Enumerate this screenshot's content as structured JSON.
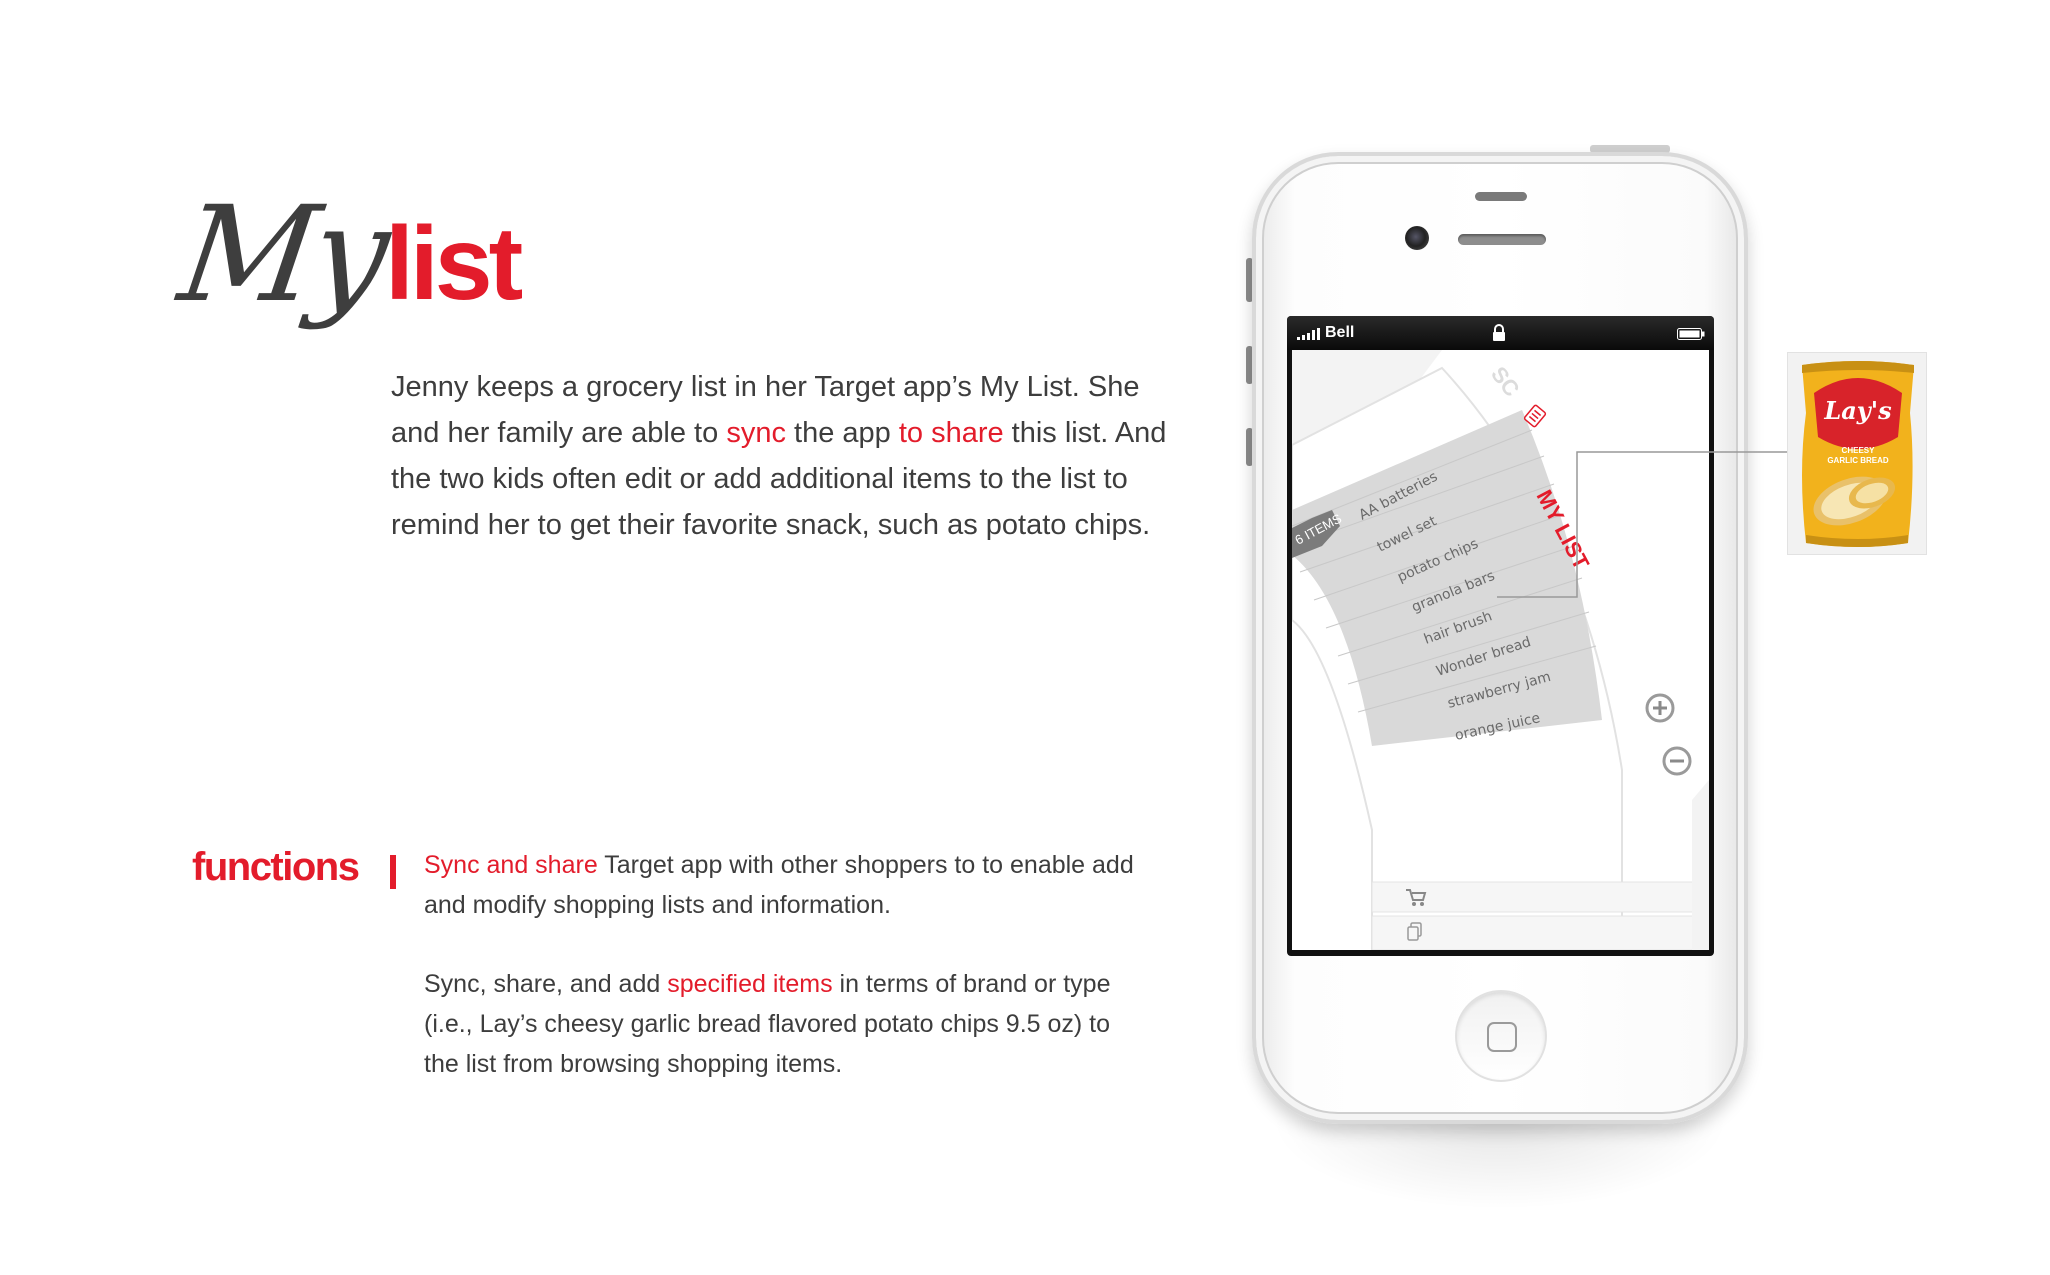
{
  "title": {
    "script_word": "My",
    "bold_word": "list"
  },
  "intro": {
    "segments": [
      {
        "text": "Jenny keeps a grocery list in her Target app’s My List. She and her family are able to ",
        "accent": false
      },
      {
        "text": "sync",
        "accent": true
      },
      {
        "text": " the app ",
        "accent": false
      },
      {
        "text": "to share",
        "accent": true
      },
      {
        "text": " this list. And the two kids often edit or add additional items to the list to remind her to get their favorite snack, such as potato chips.",
        "accent": false
      }
    ]
  },
  "functions": {
    "heading": "functions",
    "para1": [
      {
        "text": "Sync and share",
        "accent": true
      },
      {
        "text": " Target app with other shoppers to to enable add and modify shopping lists and information.",
        "accent": false
      }
    ],
    "para2": [
      {
        "text": "Sync, share, and add ",
        "accent": false
      },
      {
        "text": "specified items",
        "accent": true
      },
      {
        "text": " in terms of brand or type (i.e., Lay’s cheesy garlic bread flavored potato chips 9.5 oz) to the list from browsing shopping items.",
        "accent": false
      }
    ]
  },
  "phone": {
    "status_bar": {
      "carrier": "Bell"
    },
    "app": {
      "section_label": "MY LIST",
      "partial_label": "SC",
      "count_tag": "6 ITEMS",
      "items": [
        "AA batteries",
        "towel set",
        "potato chips",
        "granola bars",
        "hair brush",
        "Wonder bread",
        "strawberry jam",
        "orange juice"
      ],
      "icons": [
        "add-icon",
        "remove-icon",
        "cart-icon",
        "copy-icon",
        "list-icon"
      ]
    }
  },
  "product": {
    "brand": "Lay's",
    "flavor_line_1": "CHEESY",
    "flavor_line_2": "GARLIC BREAD"
  },
  "colors": {
    "accent": "#e31c2b",
    "text": "#3d3d3d",
    "bag_yellow": "#f2b21c"
  }
}
